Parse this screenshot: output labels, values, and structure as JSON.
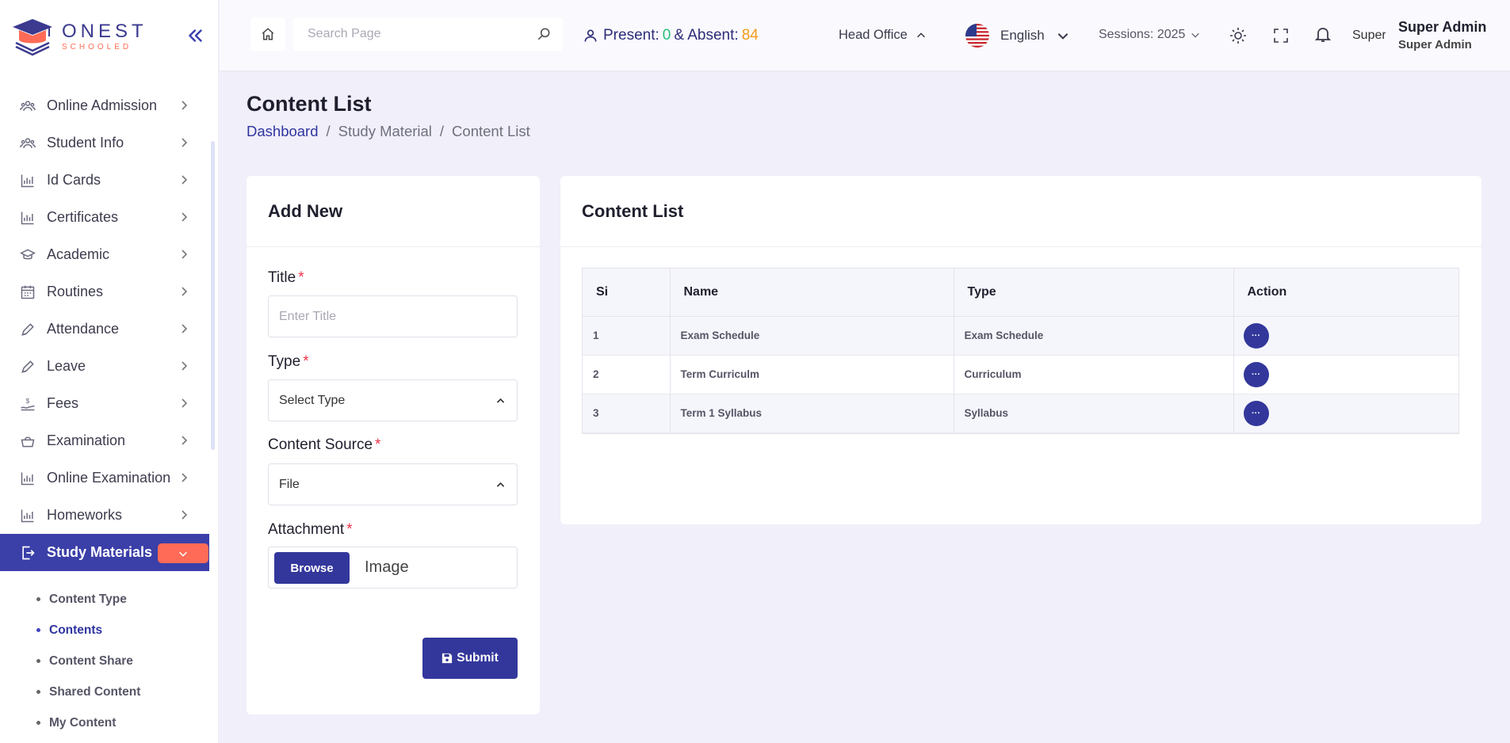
{
  "brand": {
    "name": "ONEST",
    "tagline": "SCHOOLED"
  },
  "header": {
    "search_placeholder": "Search Page",
    "present_label": "Present:",
    "present_value": "0",
    "absent_label": "& Absent:",
    "absent_value": "84",
    "branch": "Head Office",
    "language": "English",
    "sessions": "Sessions: 2025",
    "avatar_alt": "Super",
    "user_name": "Super Admin",
    "user_role": "Super Admin"
  },
  "sidebar": {
    "items": [
      {
        "label": "Online Admission",
        "icon": "users-icon"
      },
      {
        "label": "Student Info",
        "icon": "users-icon"
      },
      {
        "label": "Id Cards",
        "icon": "chart-icon"
      },
      {
        "label": "Certificates",
        "icon": "chart-icon"
      },
      {
        "label": "Academic",
        "icon": "graduation-cap-icon"
      },
      {
        "label": "Routines",
        "icon": "calendar-icon"
      },
      {
        "label": "Attendance",
        "icon": "pen-icon"
      },
      {
        "label": "Leave",
        "icon": "pen-icon"
      },
      {
        "label": "Fees",
        "icon": "money-icon"
      },
      {
        "label": "Examination",
        "icon": "basket-icon"
      },
      {
        "label": "Online Examination",
        "icon": "chart-icon"
      },
      {
        "label": "Homeworks",
        "icon": "chart-icon"
      },
      {
        "label": "Study Materials",
        "icon": "logout-icon",
        "active": true
      }
    ],
    "subitems": [
      {
        "label": "Content Type"
      },
      {
        "label": "Contents",
        "active": true
      },
      {
        "label": "Content Share"
      },
      {
        "label": "Shared Content"
      },
      {
        "label": "My Content"
      }
    ]
  },
  "page": {
    "title": "Content List",
    "breadcrumb": [
      "Dashboard",
      "Study Material",
      "Content List"
    ]
  },
  "form": {
    "heading": "Add New",
    "title_label": "Title",
    "title_placeholder": "Enter Title",
    "type_label": "Type",
    "type_value": "Select Type",
    "source_label": "Content Source",
    "source_value": "File",
    "attachment_label": "Attachment",
    "browse_label": "Browse",
    "file_placeholder": "Image",
    "submit_label": "Submit",
    "required_mark": "*"
  },
  "list": {
    "heading": "Content List",
    "columns": [
      "Si",
      "Name",
      "Type",
      "Action"
    ],
    "action_label": "···",
    "rows": [
      {
        "si": "1",
        "name": "Exam Schedule",
        "type": "Exam Schedule"
      },
      {
        "si": "2",
        "name": "Term Curriculm",
        "type": "Curriculum"
      },
      {
        "si": "3",
        "name": "Term 1 Syllabus",
        "type": "Syllabus"
      }
    ]
  },
  "colors": {
    "primary": "#33379b",
    "accent": "#ff6b57",
    "present": "#22c07a",
    "absent": "#f59a1a"
  }
}
